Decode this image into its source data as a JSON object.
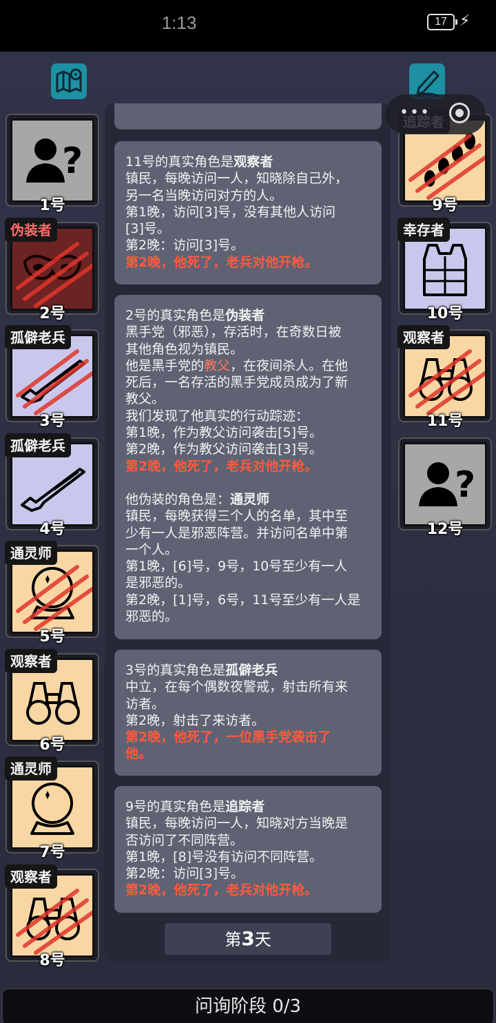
{
  "status": {
    "time": "1:13",
    "battery": "17"
  },
  "players_left": [
    {
      "num": "1号",
      "role": "",
      "role_red": false,
      "bg": "gray",
      "icon": "unknown-person-icon",
      "dead": false
    },
    {
      "num": "2号",
      "role": "伪装者",
      "role_red": true,
      "bg": "dkred",
      "icon": "mask-icon",
      "dead": true
    },
    {
      "num": "3号",
      "role": "孤僻老兵",
      "role_red": false,
      "bg": "lav",
      "icon": "rifle-icon",
      "dead": true
    },
    {
      "num": "4号",
      "role": "孤僻老兵",
      "role_red": false,
      "bg": "lav",
      "icon": "rifle-icon",
      "dead": false
    },
    {
      "num": "5号",
      "role": "通灵师",
      "role_red": false,
      "bg": "peach",
      "icon": "crystal-ball-icon",
      "dead": true
    },
    {
      "num": "6号",
      "role": "观察者",
      "role_red": false,
      "bg": "peach",
      "icon": "binoculars-icon",
      "dead": false
    },
    {
      "num": "7号",
      "role": "通灵师",
      "role_red": false,
      "bg": "peach",
      "icon": "crystal-ball-icon",
      "dead": false
    },
    {
      "num": "8号",
      "role": "观察者",
      "role_red": false,
      "bg": "peach",
      "icon": "binoculars-icon",
      "dead": true
    }
  ],
  "players_right": [
    {
      "num": "9号",
      "role": "追踪者",
      "role_red": false,
      "bg": "peach",
      "icon": "footprints-icon",
      "dead": true
    },
    {
      "num": "10号",
      "role": "幸存者",
      "role_red": false,
      "bg": "lav",
      "icon": "vest-icon",
      "dead": false
    },
    {
      "num": "11号",
      "role": "观察者",
      "role_red": false,
      "bg": "peach",
      "icon": "binoculars-icon",
      "dead": true
    },
    {
      "num": "12号",
      "role": "",
      "role_red": false,
      "bg": "gray",
      "icon": "unknown-person-icon",
      "dead": false
    }
  ],
  "log": {
    "e1": {
      "l1a": "11号的真实角色是",
      "l1b": "观察者",
      "l2": "镇民，每晚访问一人，知晓除自己外，",
      "l3": "另一名当晚访问对方的人。",
      "l4": "第1晚，访问[3]号，没有其他人访问",
      "l5": "[3]号。",
      "l6": "第2晚：访问[3]号。",
      "l7": "第2晚，他死了，老兵对他开枪。"
    },
    "e2": {
      "l1a": "2号的真实角色是",
      "l1b": "伪装者",
      "l2": "黑手党（邪恶），存活时，在奇数日被",
      "l3": "其他角色视为镇民。",
      "l4a": "他是黑手党的",
      "l4b": "教父",
      "l4c": "，在夜间杀人。在他",
      "l5": "死后，一名存活的黑手党成员成为了新",
      "l6": "教父。",
      "l7": "我们发现了他真实的行动踪迹：",
      "l8": "第1晚，作为教父访问袭击[5]号。",
      "l9": "第2晚，作为教父访问袭击[3]号。",
      "l10": "第2晚，他死了，老兵对他开枪。",
      "l11a": "他伪装的角色是：",
      "l11b": "通灵师",
      "l12": "镇民，每晚获得三个人的名单，其中至",
      "l13": "少有一人是邪恶阵营。并访问名单中第",
      "l14": "一个人。",
      "l15": "第1晚，[6]号，9号，10号至少有一人",
      "l16": "是邪恶的。",
      "l17": "第2晚，[1]号，6号，11号至少有一人是",
      "l18": "邪恶的。"
    },
    "e3": {
      "l1a": "3号的真实角色是",
      "l1b": "孤僻老兵",
      "l2": "中立，在每个偶数夜警戒，射击所有来",
      "l3": "访者。",
      "l4": "第2晚，射击了来访者。",
      "l5": "第2晚，他死了，一位黑手党袭击了",
      "l6": "他。"
    },
    "e4": {
      "l1a": "9号的真实角色是",
      "l1b": "追踪者",
      "l2": "镇民，每晚访问一人，知晓对方当晚是",
      "l3": "否访问了不同阵营。",
      "l4": "第1晚，[8]号没有访问不同阵营。",
      "l5": "第2晚：访问[3]号。",
      "l6": "第2晚，他死了，老兵对他开枪。"
    }
  },
  "day": {
    "pre": "第",
    "num": "3",
    "post": "天"
  },
  "footer": "问询阶段 0/3",
  "colors": {
    "accent_teal": "#1f8fa3",
    "death_red": "#ff5a3c"
  }
}
